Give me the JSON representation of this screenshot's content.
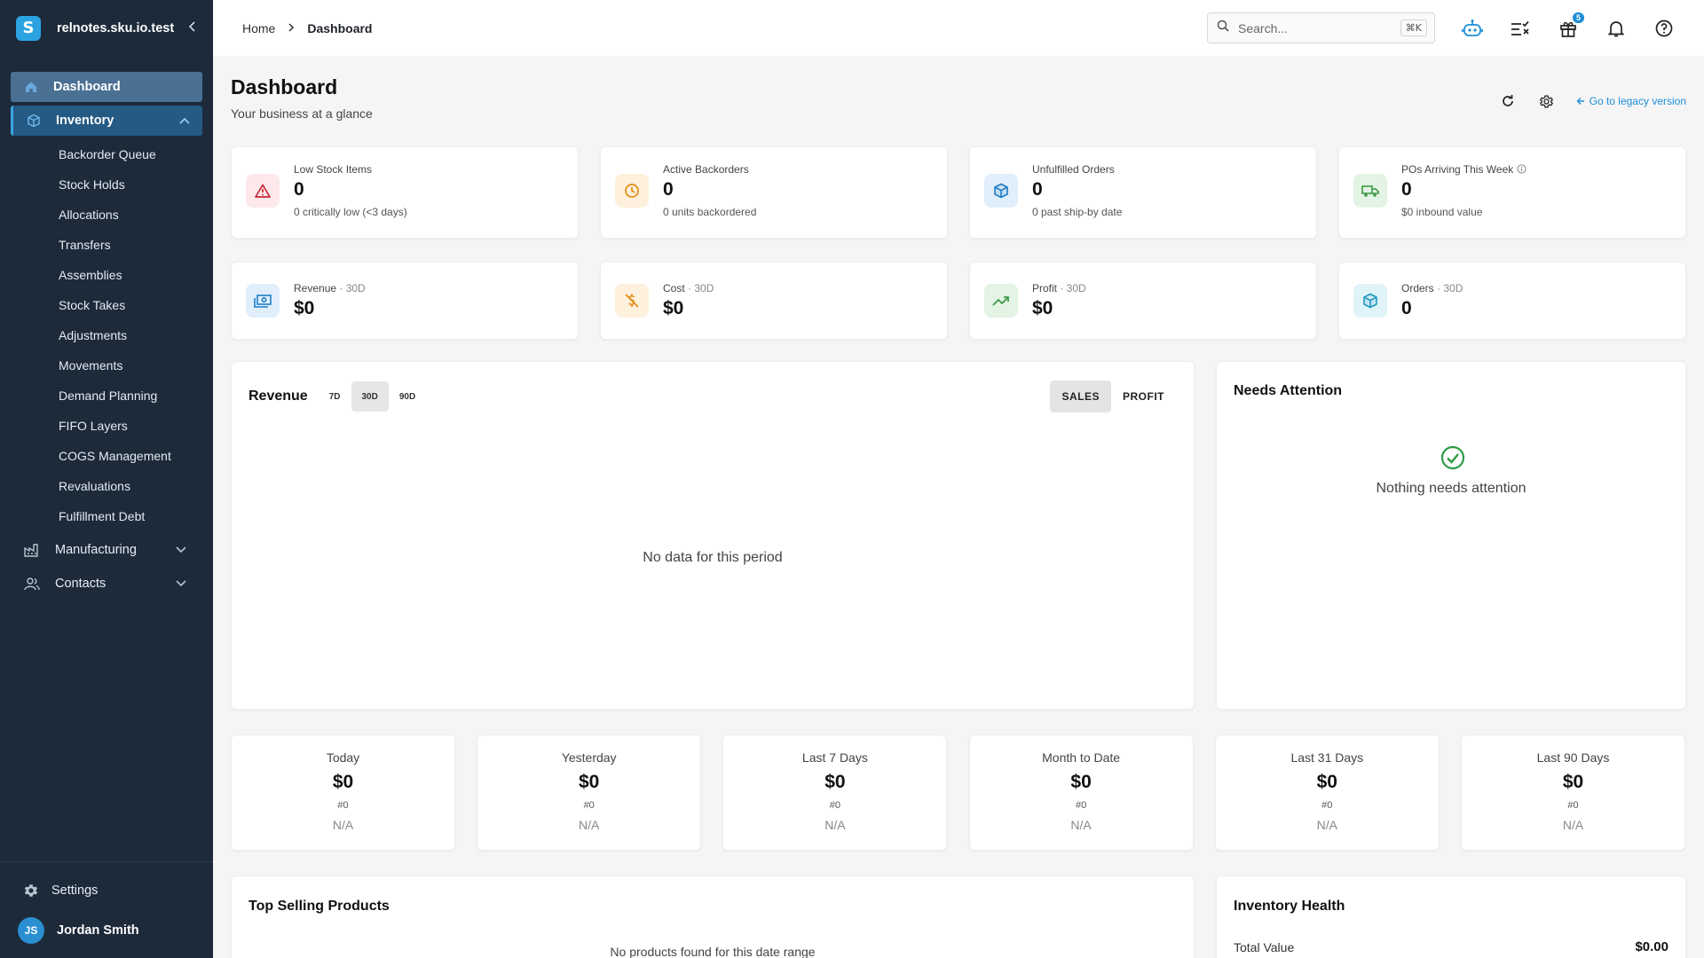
{
  "app": {
    "org_name": "relnotes.sku.io.test",
    "logo_letter": "S"
  },
  "sidebar": {
    "items": [
      {
        "label": "Dashboard"
      },
      {
        "label": "Inventory"
      }
    ],
    "inventory_sub": [
      "Backorder Queue",
      "Stock Holds",
      "Allocations",
      "Transfers",
      "Assemblies",
      "Stock Takes",
      "Adjustments",
      "Movements",
      "Demand Planning",
      "FIFO Layers",
      "COGS Management",
      "Revaluations",
      "Fulfillment Debt"
    ],
    "manufacturing": "Manufacturing",
    "contacts": "Contacts",
    "settings": "Settings",
    "user": {
      "initials": "JS",
      "name": "Jordan Smith"
    }
  },
  "header": {
    "breadcrumb": [
      "Home",
      "Dashboard"
    ],
    "search_placeholder": "Search...",
    "search_shortcut": "⌘K",
    "gift_badge": "5"
  },
  "page": {
    "title": "Dashboard",
    "subtitle": "Your business at a glance",
    "legacy_link": "Go to legacy version"
  },
  "kpis_row1": [
    {
      "label": "Low Stock Items",
      "value": "0",
      "note": "0 critically low (<3 days)",
      "icon": "warning-icon",
      "bg": "#fde8ea",
      "fg": "#c62835"
    },
    {
      "label": "Active Backorders",
      "value": "0",
      "note": "0 units backordered",
      "icon": "clock-icon",
      "bg": "#fdf0dc",
      "fg": "#e58a12"
    },
    {
      "label": "Unfulfilled Orders",
      "value": "0",
      "note": "0 past ship-by date",
      "icon": "box-icon",
      "bg": "#e1eefb",
      "fg": "#1f7fc8"
    },
    {
      "label": "POs Arriving This Week",
      "value": "0",
      "note": "$0 inbound value",
      "icon": "truck-icon",
      "bg": "#e3f3e4",
      "fg": "#3e9a45"
    }
  ],
  "kpis_row2": [
    {
      "label": "Revenue",
      "period": "· 30D",
      "value": "$0",
      "icon": "money-icon",
      "bg": "#e1eefb",
      "fg": "#1f7fc8"
    },
    {
      "label": "Cost",
      "period": "· 30D",
      "value": "$0",
      "icon": "no-money-icon",
      "bg": "#fdf0dc",
      "fg": "#e58a12"
    },
    {
      "label": "Profit",
      "period": "· 30D",
      "value": "$0",
      "icon": "trending-up-icon",
      "bg": "#e3f3e4",
      "fg": "#3e9a45"
    },
    {
      "label": "Orders",
      "period": "· 30D",
      "value": "0",
      "icon": "box-icon",
      "bg": "#e0f3f8",
      "fg": "#1f9ac2"
    }
  ],
  "revenue_chart": {
    "title": "Revenue",
    "ranges": [
      "7D",
      "30D",
      "90D"
    ],
    "selected_range": "30D",
    "modes": [
      "SALES",
      "PROFIT"
    ],
    "selected_mode": "SALES",
    "empty": "No data for this period"
  },
  "attention": {
    "title": "Needs Attention",
    "empty": "Nothing needs attention"
  },
  "periods": [
    {
      "title": "Today",
      "value": "$0",
      "count": "#0",
      "change": "N/A"
    },
    {
      "title": "Yesterday",
      "value": "$0",
      "count": "#0",
      "change": "N/A"
    },
    {
      "title": "Last 7 Days",
      "value": "$0",
      "count": "#0",
      "change": "N/A"
    },
    {
      "title": "Month to Date",
      "value": "$0",
      "count": "#0",
      "change": "N/A"
    },
    {
      "title": "Last 31 Days",
      "value": "$0",
      "count": "#0",
      "change": "N/A"
    },
    {
      "title": "Last 90 Days",
      "value": "$0",
      "count": "#0",
      "change": "N/A"
    }
  ],
  "top_products": {
    "title": "Top Selling Products",
    "empty": "No products found for this date range"
  },
  "inventory_health": {
    "title": "Inventory Health",
    "total_label": "Total Value",
    "total_value": "$0.00"
  },
  "colors": {
    "sidebar_bg": "#1c2a3a",
    "accent": "#1f8fd6",
    "success": "#2e9a44"
  }
}
